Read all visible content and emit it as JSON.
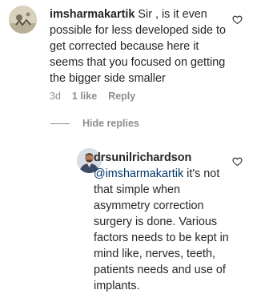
{
  "comment": {
    "username": "imsharmakartik",
    "text": " Sir , is it even possible for less developed side to get corrected because here it seems that you focused on getting the bigger side smaller",
    "time": "3d",
    "likes": "1 like",
    "reply_label": "Reply",
    "avatar_icon": "profile-photo",
    "like_icon": "heart-outline-icon"
  },
  "hide_replies_label": "Hide replies",
  "reply": {
    "username": "drsunilrichardson",
    "mention": "@imsharmakartik",
    "text": " it's not that simple when asymmetry correction surgery is done. Various factors needs to be kept in mind like, nerves, teeth, patients needs and use of implants.",
    "avatar_icon": "profile-photo",
    "like_icon": "heart-outline-icon"
  },
  "colors": {
    "text": "#262626",
    "muted": "#8e8e8e",
    "mention": "#00376b"
  }
}
